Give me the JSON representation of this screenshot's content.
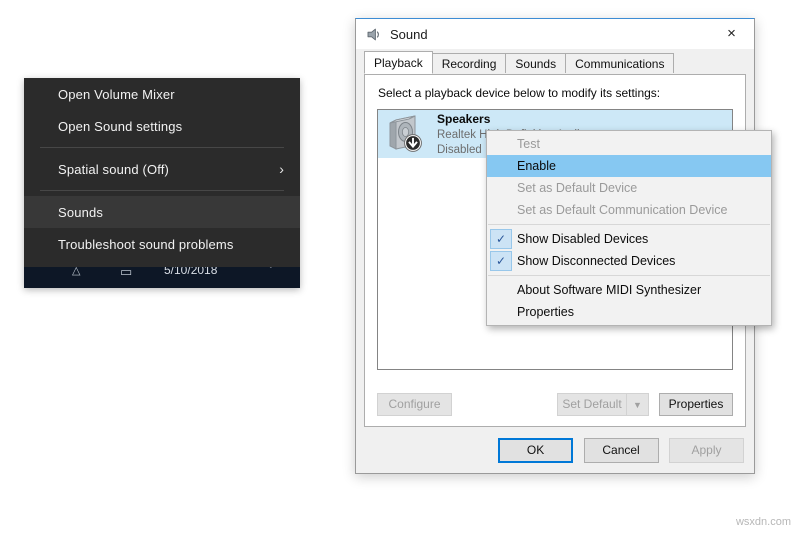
{
  "tray_menu": {
    "items": [
      {
        "label": "Open Volume Mixer",
        "selected": false,
        "submenu": false
      },
      {
        "label": "Open Sound settings",
        "selected": false,
        "submenu": false
      },
      {
        "label": "Spatial sound (Off)",
        "selected": false,
        "submenu": true
      },
      {
        "label": "Sounds",
        "selected": true,
        "submenu": false
      },
      {
        "label": "Troubleshoot sound problems",
        "selected": false,
        "submenu": false
      }
    ],
    "submenu_icon": "chevron-right-icon",
    "background_color": "#2b2b2b",
    "highlight_color": "#383838"
  },
  "taskbar": {
    "clock_date": "5/10/2018",
    "glyph_left": "△",
    "glyph_mid": "▭",
    "glyph_right": "ˇ",
    "background_color": "#0d1726"
  },
  "sound_window": {
    "title": "Sound",
    "title_icon": "speaker-icon",
    "close_label": "×",
    "close_icon": "close-icon",
    "accent_color": "#0078d7",
    "tabs": [
      {
        "label": "Playback",
        "active": true
      },
      {
        "label": "Recording",
        "active": false
      },
      {
        "label": "Sounds",
        "active": false
      },
      {
        "label": "Communications",
        "active": false
      }
    ],
    "playback": {
      "hint": "Select a playback device below to modify its settings:",
      "devices": [
        {
          "name": "Speakers",
          "driver": "Realtek High Definition Audio",
          "state": "Disabled",
          "icon": "speaker-disabled-icon",
          "selected": true
        }
      ],
      "buttons": {
        "configure": {
          "label": "Configure",
          "enabled": false
        },
        "set_default": {
          "label": "Set Default",
          "enabled": false,
          "dropdown_icon": "chevron-down-icon"
        },
        "properties": {
          "label": "Properties",
          "enabled": true
        }
      }
    },
    "footer": {
      "ok": {
        "label": "OK",
        "enabled": true,
        "default": true
      },
      "cancel": {
        "label": "Cancel",
        "enabled": true,
        "default": false
      },
      "apply": {
        "label": "Apply",
        "enabled": false,
        "default": false
      }
    }
  },
  "device_context_menu": {
    "items": [
      {
        "type": "item",
        "label": "Test",
        "enabled": false,
        "checked": false,
        "highlighted": false
      },
      {
        "type": "item",
        "label": "Enable",
        "enabled": true,
        "checked": false,
        "highlighted": true
      },
      {
        "type": "item",
        "label": "Set as Default Device",
        "enabled": false,
        "checked": false,
        "highlighted": false
      },
      {
        "type": "item",
        "label": "Set as Default Communication Device",
        "enabled": false,
        "checked": false,
        "highlighted": false
      },
      {
        "type": "separator"
      },
      {
        "type": "item",
        "label": "Show Disabled Devices",
        "enabled": true,
        "checked": true,
        "highlighted": false
      },
      {
        "type": "item",
        "label": "Show Disconnected Devices",
        "enabled": true,
        "checked": true,
        "highlighted": false
      },
      {
        "type": "separator"
      },
      {
        "type": "item",
        "label": "About Software MIDI Synthesizer",
        "enabled": true,
        "checked": false,
        "highlighted": false
      },
      {
        "type": "item",
        "label": "Properties",
        "enabled": true,
        "checked": false,
        "highlighted": false
      }
    ],
    "check_icon": "checkmark-icon",
    "highlight_color": "#86c8f2"
  },
  "watermark": {
    "text": "wsxdn.com"
  }
}
